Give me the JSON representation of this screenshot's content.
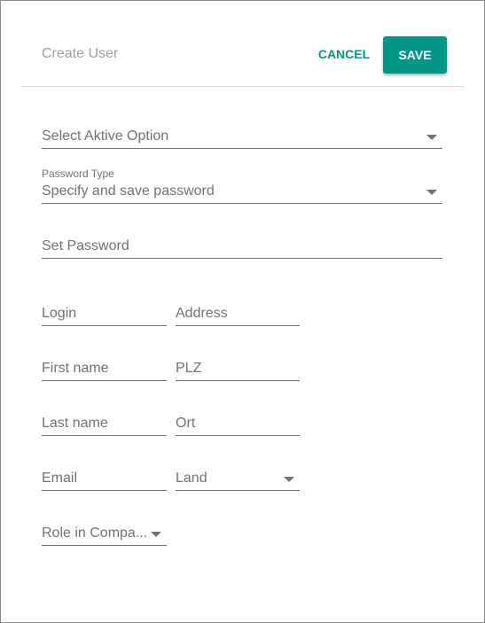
{
  "header": {
    "title": "Create User",
    "cancel_label": "CANCEL",
    "save_label": "SAVE"
  },
  "colors": {
    "accent": "#009688",
    "field_text": "#6e7474",
    "title_text": "#9aa0a0"
  },
  "form": {
    "active_option": {
      "placeholder": "Select Aktive Option",
      "icon": "chevron-down-icon"
    },
    "password_type": {
      "label": "Password Type",
      "value": "Specify and save password",
      "icon": "chevron-down-icon"
    },
    "set_password": {
      "placeholder": "Set Password"
    },
    "login": {
      "placeholder": "Login"
    },
    "address": {
      "placeholder": "Address"
    },
    "first_name": {
      "placeholder": "First name"
    },
    "plz": {
      "placeholder": "PLZ"
    },
    "last_name": {
      "placeholder": "Last name"
    },
    "ort": {
      "placeholder": "Ort"
    },
    "email": {
      "placeholder": "Email"
    },
    "land": {
      "placeholder": "Land",
      "icon": "chevron-down-icon"
    },
    "role": {
      "placeholder": "Role in Compa...",
      "icon": "chevron-down-icon"
    }
  }
}
